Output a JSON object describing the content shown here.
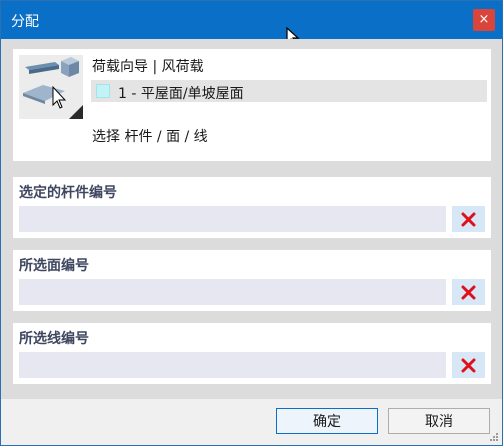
{
  "window": {
    "title": "分配",
    "close_glyph": "×"
  },
  "wizard": {
    "title": "荷载向导 | 风荷载",
    "load_case": "1 - 平屋面/单坡屋面",
    "load_color": "#c2f4f7",
    "select_label": "选择 杆件 / 面 / 线",
    "icon": "load-wizard-icon"
  },
  "sections": {
    "members": {
      "label": "选定的杆件编号",
      "value": ""
    },
    "surfaces": {
      "label": "所选面编号",
      "value": ""
    },
    "lines": {
      "label": "所选线编号",
      "value": ""
    }
  },
  "buttons": {
    "ok": "确定",
    "cancel": "取消"
  },
  "colors": {
    "titlebar": "#0a6fc7",
    "close": "#d9453a",
    "clear_icon": "#e0101a"
  }
}
